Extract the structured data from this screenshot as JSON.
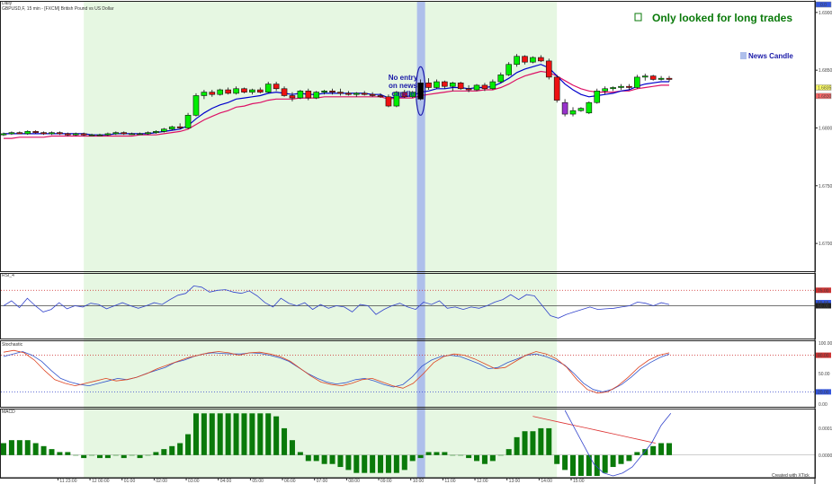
{
  "window": {
    "label": "Daily",
    "symbol_line": "GBPUSD,F, 15 min - [FXCM] British Pound vs US Dollar",
    "footer": "Created with XTick"
  },
  "annotations": {
    "title": "Only looked for long trades",
    "legend_news": "News Candle",
    "no_entry": [
      "No entry",
      "on news",
      "candle"
    ]
  },
  "colors": {
    "bull": "#00ee00",
    "bear": "#ee1111",
    "news_candle": "#000000",
    "purple_candle": "#9932cc",
    "ema_fast": "#0000cc",
    "ema_slow": "#dd1166",
    "long_zone": "#e6f7e2",
    "news_band": "#aebfeb",
    "macd_bar": "#0a7a0a"
  },
  "chart_data": [
    {
      "type": "candlestick",
      "name": "price",
      "ylim": [
        1.6676,
        1.691
      ],
      "y_ticks": [
        "1.6900",
        "1.6850",
        "1.6800",
        "1.6750",
        "1.6700"
      ],
      "x_labels": [
        "11 23:00",
        "12 00:00",
        "01:00",
        "02:00",
        "03:00",
        "04:00",
        "05:00",
        "06:00",
        "07:00",
        "08:00",
        "09:00",
        "10:00",
        "11:00",
        "12:00",
        "13:00",
        "14:00",
        "15:00"
      ],
      "price_labels": {
        "last": "1.6835",
        "ema": "1.6830",
        "top": "0.0"
      },
      "long_zone": {
        "from_bar": 10,
        "to_bar": 69
      },
      "news_bar": 52,
      "candles": [
        [
          1.6794,
          1.6796,
          1.6793,
          1.6795
        ],
        [
          1.6795,
          1.6797,
          1.6794,
          1.6796
        ],
        [
          1.6796,
          1.6797,
          1.6795,
          1.6795
        ],
        [
          1.6795,
          1.6798,
          1.6794,
          1.6797
        ],
        [
          1.6797,
          1.6798,
          1.6795,
          1.6796
        ],
        [
          1.6796,
          1.6797,
          1.6794,
          1.6795
        ],
        [
          1.6795,
          1.6797,
          1.6794,
          1.6796
        ],
        [
          1.6796,
          1.6797,
          1.6794,
          1.6795
        ],
        [
          1.6795,
          1.6796,
          1.6793,
          1.6794
        ],
        [
          1.6794,
          1.6796,
          1.6793,
          1.6795
        ],
        [
          1.6795,
          1.6796,
          1.6793,
          1.6794
        ],
        [
          1.6794,
          1.6795,
          1.6793,
          1.6794
        ],
        [
          1.6794,
          1.6795,
          1.6793,
          1.6794
        ],
        [
          1.6794,
          1.6796,
          1.6793,
          1.6795
        ],
        [
          1.6795,
          1.6797,
          1.6794,
          1.6796
        ],
        [
          1.6796,
          1.6797,
          1.6794,
          1.6795
        ],
        [
          1.6795,
          1.6796,
          1.6794,
          1.6795
        ],
        [
          1.6795,
          1.6796,
          1.6794,
          1.6795
        ],
        [
          1.6795,
          1.6797,
          1.6794,
          1.6796
        ],
        [
          1.6796,
          1.6798,
          1.6795,
          1.6797
        ],
        [
          1.6797,
          1.68,
          1.6796,
          1.6799
        ],
        [
          1.6799,
          1.6802,
          1.6798,
          1.6801
        ],
        [
          1.6801,
          1.6804,
          1.6799,
          1.68
        ],
        [
          1.68,
          1.6813,
          1.6799,
          1.6811
        ],
        [
          1.6811,
          1.683,
          1.681,
          1.6828
        ],
        [
          1.6828,
          1.6833,
          1.6825,
          1.6831
        ],
        [
          1.6831,
          1.6833,
          1.6827,
          1.6829
        ],
        [
          1.6829,
          1.6834,
          1.6828,
          1.6833
        ],
        [
          1.6833,
          1.6835,
          1.6829,
          1.683
        ],
        [
          1.683,
          1.6836,
          1.6829,
          1.6834
        ],
        [
          1.6834,
          1.6835,
          1.683,
          1.6831
        ],
        [
          1.6831,
          1.6834,
          1.6829,
          1.6833
        ],
        [
          1.6833,
          1.6835,
          1.683,
          1.6831
        ],
        [
          1.6831,
          1.684,
          1.683,
          1.6838
        ],
        [
          1.6838,
          1.684,
          1.6832,
          1.6834
        ],
        [
          1.6834,
          1.6836,
          1.6827,
          1.6828
        ],
        [
          1.6828,
          1.6831,
          1.6823,
          1.6826
        ],
        [
          1.6826,
          1.6833,
          1.6825,
          1.6832
        ],
        [
          1.6832,
          1.6834,
          1.6824,
          1.6826
        ],
        [
          1.6826,
          1.6832,
          1.6825,
          1.6831
        ],
        [
          1.6831,
          1.6833,
          1.6829,
          1.6832
        ],
        [
          1.6832,
          1.6834,
          1.6829,
          1.6831
        ],
        [
          1.6831,
          1.6834,
          1.6828,
          1.683
        ],
        [
          1.683,
          1.6832,
          1.6828,
          1.6829
        ],
        [
          1.6829,
          1.6831,
          1.6827,
          1.683
        ],
        [
          1.683,
          1.6832,
          1.6828,
          1.6829
        ],
        [
          1.6829,
          1.6831,
          1.6827,
          1.6828
        ],
        [
          1.6828,
          1.683,
          1.6826,
          1.6827
        ],
        [
          1.6827,
          1.6829,
          1.6818,
          1.6819
        ],
        [
          1.6819,
          1.6832,
          1.6818,
          1.6831
        ],
        [
          1.6831,
          1.6833,
          1.6826,
          1.6827
        ],
        [
          1.6827,
          1.6832,
          1.6826,
          1.6831
        ],
        [
          1.6825,
          1.6842,
          1.6824,
          1.6839
        ],
        [
          1.6839,
          1.6843,
          1.6833,
          1.6835
        ],
        [
          1.6835,
          1.6842,
          1.6834,
          1.684
        ],
        [
          1.684,
          1.6841,
          1.6834,
          1.6836
        ],
        [
          1.6836,
          1.684,
          1.6832,
          1.6839
        ],
        [
          1.6839,
          1.684,
          1.6833,
          1.6834
        ],
        [
          1.6834,
          1.6837,
          1.6831,
          1.6833
        ],
        [
          1.6833,
          1.6838,
          1.6832,
          1.6837
        ],
        [
          1.6837,
          1.6839,
          1.6832,
          1.6834
        ],
        [
          1.6834,
          1.6842,
          1.6833,
          1.684
        ],
        [
          1.684,
          1.6848,
          1.6839,
          1.6846
        ],
        [
          1.6846,
          1.6857,
          1.6845,
          1.6855
        ],
        [
          1.6855,
          1.6864,
          1.6853,
          1.6862
        ],
        [
          1.6862,
          1.6863,
          1.6855,
          1.6857
        ],
        [
          1.6857,
          1.6862,
          1.6856,
          1.6861
        ],
        [
          1.6861,
          1.6863,
          1.6857,
          1.6858
        ],
        [
          1.6858,
          1.686,
          1.6842,
          1.6844
        ],
        [
          1.6844,
          1.6846,
          1.6822,
          1.6824
        ],
        [
          1.6822,
          1.6825,
          1.681,
          1.6812
        ],
        [
          1.6812,
          1.6818,
          1.681,
          1.6815
        ],
        [
          1.6815,
          1.6818,
          1.6814,
          1.6817
        ],
        [
          1.6813,
          1.6823,
          1.6812,
          1.6822
        ],
        [
          1.6822,
          1.6834,
          1.6821,
          1.6832
        ],
        [
          1.6832,
          1.6836,
          1.6829,
          1.6834
        ],
        [
          1.6834,
          1.6836,
          1.6832,
          1.6835
        ],
        [
          1.6835,
          1.6838,
          1.6833,
          1.6836
        ],
        [
          1.6836,
          1.6838,
          1.6833,
          1.6835
        ],
        [
          1.6835,
          1.6846,
          1.6834,
          1.6844
        ],
        [
          1.6844,
          1.6847,
          1.6841,
          1.6845
        ],
        [
          1.6845,
          1.6846,
          1.6841,
          1.6842
        ],
        [
          1.6842,
          1.6845,
          1.6841,
          1.6843
        ],
        [
          1.6843,
          1.6845,
          1.684,
          1.6842
        ]
      ],
      "purple_bar": 70,
      "ema_fast": [
        1.6795,
        1.6795,
        1.6795,
        1.6795,
        1.6795,
        1.6795,
        1.6795,
        1.6795,
        1.6795,
        1.6795,
        1.6795,
        1.6794,
        1.6794,
        1.6794,
        1.6795,
        1.6795,
        1.6795,
        1.6795,
        1.6795,
        1.6796,
        1.6797,
        1.6798,
        1.6799,
        1.6802,
        1.6808,
        1.6813,
        1.6817,
        1.682,
        1.6822,
        1.6825,
        1.6826,
        1.6827,
        1.6828,
        1.683,
        1.6831,
        1.683,
        1.6829,
        1.683,
        1.6829,
        1.6829,
        1.683,
        1.683,
        1.683,
        1.683,
        1.683,
        1.683,
        1.6829,
        1.6829,
        1.6826,
        1.6827,
        1.6827,
        1.6828,
        1.6831,
        1.6832,
        1.6834,
        1.6834,
        1.6835,
        1.6835,
        1.6834,
        1.6835,
        1.6835,
        1.6836,
        1.6839,
        1.6843,
        1.6848,
        1.6851,
        1.6853,
        1.6855,
        1.6852,
        1.6845,
        1.6838,
        1.6833,
        1.6829,
        1.6827,
        1.6828,
        1.6829,
        1.683,
        1.6832,
        1.6833,
        1.6836,
        1.6838,
        1.6839,
        1.684,
        1.684
      ],
      "ema_slow": [
        1.6791,
        1.6791,
        1.6792,
        1.6792,
        1.6792,
        1.6792,
        1.6793,
        1.6793,
        1.6793,
        1.6793,
        1.6793,
        1.6793,
        1.6793,
        1.6793,
        1.6793,
        1.6793,
        1.6793,
        1.6794,
        1.6794,
        1.6794,
        1.6795,
        1.6796,
        1.6797,
        1.6799,
        1.6803,
        1.6807,
        1.681,
        1.6813,
        1.6815,
        1.6818,
        1.6819,
        1.6821,
        1.6822,
        1.6824,
        1.6825,
        1.6825,
        1.6825,
        1.6826,
        1.6826,
        1.6826,
        1.6827,
        1.6827,
        1.6827,
        1.6827,
        1.6827,
        1.6827,
        1.6827,
        1.6827,
        1.6825,
        1.6826,
        1.6826,
        1.6826,
        1.6828,
        1.6829,
        1.683,
        1.6831,
        1.6832,
        1.6832,
        1.6832,
        1.6832,
        1.6833,
        1.6833,
        1.6835,
        1.6838,
        1.6842,
        1.6845,
        1.6847,
        1.6849,
        1.6848,
        1.6845,
        1.6841,
        1.6837,
        1.6834,
        1.6832,
        1.6831,
        1.6831,
        1.6831,
        1.6832,
        1.6832,
        1.6834,
        1.6835,
        1.6836,
        1.6837,
        1.6837
      ]
    },
    {
      "type": "line",
      "name": "RSI",
      "label": "RSI_4",
      "ylim": [
        0,
        100
      ],
      "levels": [
        75,
        50
      ],
      "level_labels": [
        "75.00",
        "50.00"
      ],
      "last_label": "55.55",
      "values": [
        50,
        58,
        47,
        62,
        50,
        40,
        44,
        55,
        45,
        50,
        48,
        54,
        52,
        45,
        50,
        55,
        50,
        46,
        50,
        55,
        52,
        60,
        67,
        70,
        82,
        80,
        72,
        75,
        76,
        72,
        70,
        74,
        66,
        55,
        48,
        62,
        54,
        50,
        55,
        44,
        52,
        46,
        50,
        48,
        40,
        52,
        50,
        36,
        44,
        50,
        54,
        48,
        44,
        56,
        52,
        58,
        46,
        48,
        44,
        48,
        46,
        50,
        56,
        60,
        68,
        60,
        68,
        66,
        50,
        34,
        30,
        36,
        40,
        44,
        48,
        44,
        45,
        46,
        48,
        50,
        56,
        54,
        50,
        55,
        52
      ]
    },
    {
      "type": "line",
      "name": "Stochastic",
      "label": "Stochastic",
      "ylim": [
        0,
        100
      ],
      "y_ticks": [
        "100.00",
        "50.00",
        "0.00"
      ],
      "levels": [
        80,
        20
      ],
      "level_labels": [
        "80.00",
        "20.00"
      ],
      "series": [
        {
          "values": [
            78,
            82,
            86,
            80,
            70,
            55,
            42,
            36,
            32,
            30,
            34,
            38,
            42,
            40,
            44,
            50,
            55,
            60,
            68,
            72,
            78,
            82,
            84,
            83,
            82,
            82,
            84,
            83,
            80,
            76,
            70,
            60,
            50,
            42,
            36,
            33,
            35,
            40,
            42,
            38,
            32,
            28,
            32,
            45,
            62,
            72,
            78,
            80,
            78,
            72,
            66,
            58,
            60,
            68,
            74,
            80,
            82,
            78,
            72,
            64,
            50,
            34,
            24,
            20,
            24,
            32,
            44,
            58,
            68,
            76,
            82
          ]
        },
        {
          "values": [
            85,
            88,
            84,
            72,
            55,
            40,
            34,
            30,
            34,
            38,
            42,
            38,
            40,
            44,
            50,
            58,
            64,
            70,
            76,
            80,
            84,
            86,
            84,
            80,
            84,
            85,
            82,
            78,
            70,
            58,
            46,
            36,
            32,
            30,
            34,
            40,
            42,
            36,
            30,
            26,
            34,
            50,
            68,
            78,
            82,
            80,
            74,
            66,
            58,
            60,
            70,
            80,
            86,
            82,
            74,
            60,
            40,
            24,
            18,
            20,
            30,
            44,
            60,
            72,
            80,
            84
          ]
        }
      ]
    },
    {
      "type": "bar",
      "name": "MACD",
      "label": "MACD",
      "y_ticks": [
        "0.0001",
        "0.0000"
      ],
      "ylim": [
        -0.0007,
        0.0015
      ],
      "values": [
        0.0004,
        0.0005,
        0.0005,
        0.0005,
        0.0004,
        0.0003,
        0.0002,
        0.0001,
        0.0001,
        0.0,
        -0.0001,
        0.0,
        -0.0001,
        -0.0001,
        0.0,
        -0.0001,
        0.0,
        -0.0001,
        0.0,
        0.0001,
        0.0002,
        0.0003,
        0.0004,
        0.0007,
        0.0014,
        0.0014,
        0.0014,
        0.0014,
        0.0014,
        0.0014,
        0.0014,
        0.0014,
        0.0014,
        0.0014,
        0.0013,
        0.0009,
        0.0005,
        0.0001,
        -0.0002,
        -0.0002,
        -0.0003,
        -0.0003,
        -0.0004,
        -0.0005,
        -0.0006,
        -0.0006,
        -0.0006,
        -0.0006,
        -0.0006,
        -0.0006,
        -0.0005,
        -0.0002,
        -0.0001,
        0.0001,
        0.0001,
        0.0001,
        0.0,
        0.0,
        -0.0001,
        -0.0002,
        -0.0003,
        -0.0002,
        0.0,
        0.0002,
        0.0006,
        0.0008,
        0.0008,
        0.0009,
        0.0009,
        -0.0003,
        -0.0005,
        -0.0007,
        -0.0007,
        -0.0007,
        -0.0007,
        -0.0006,
        -0.0004,
        -0.0003,
        -0.0002,
        0.0001,
        0.0002,
        0.0003,
        0.0004,
        0.0004
      ],
      "signal_red": [
        0.0013,
        0.0012,
        0.0011,
        0.001,
        0.0009,
        0.0008,
        0.0007,
        0.0006,
        0.0005,
        0.0004
      ],
      "signal_blue": [
        0.0015,
        0.0009,
        0.0003,
        -0.0003,
        -0.0006,
        -0.0007,
        -0.0006,
        -0.0004,
        0.0,
        0.0004,
        0.001,
        0.0014
      ]
    }
  ]
}
